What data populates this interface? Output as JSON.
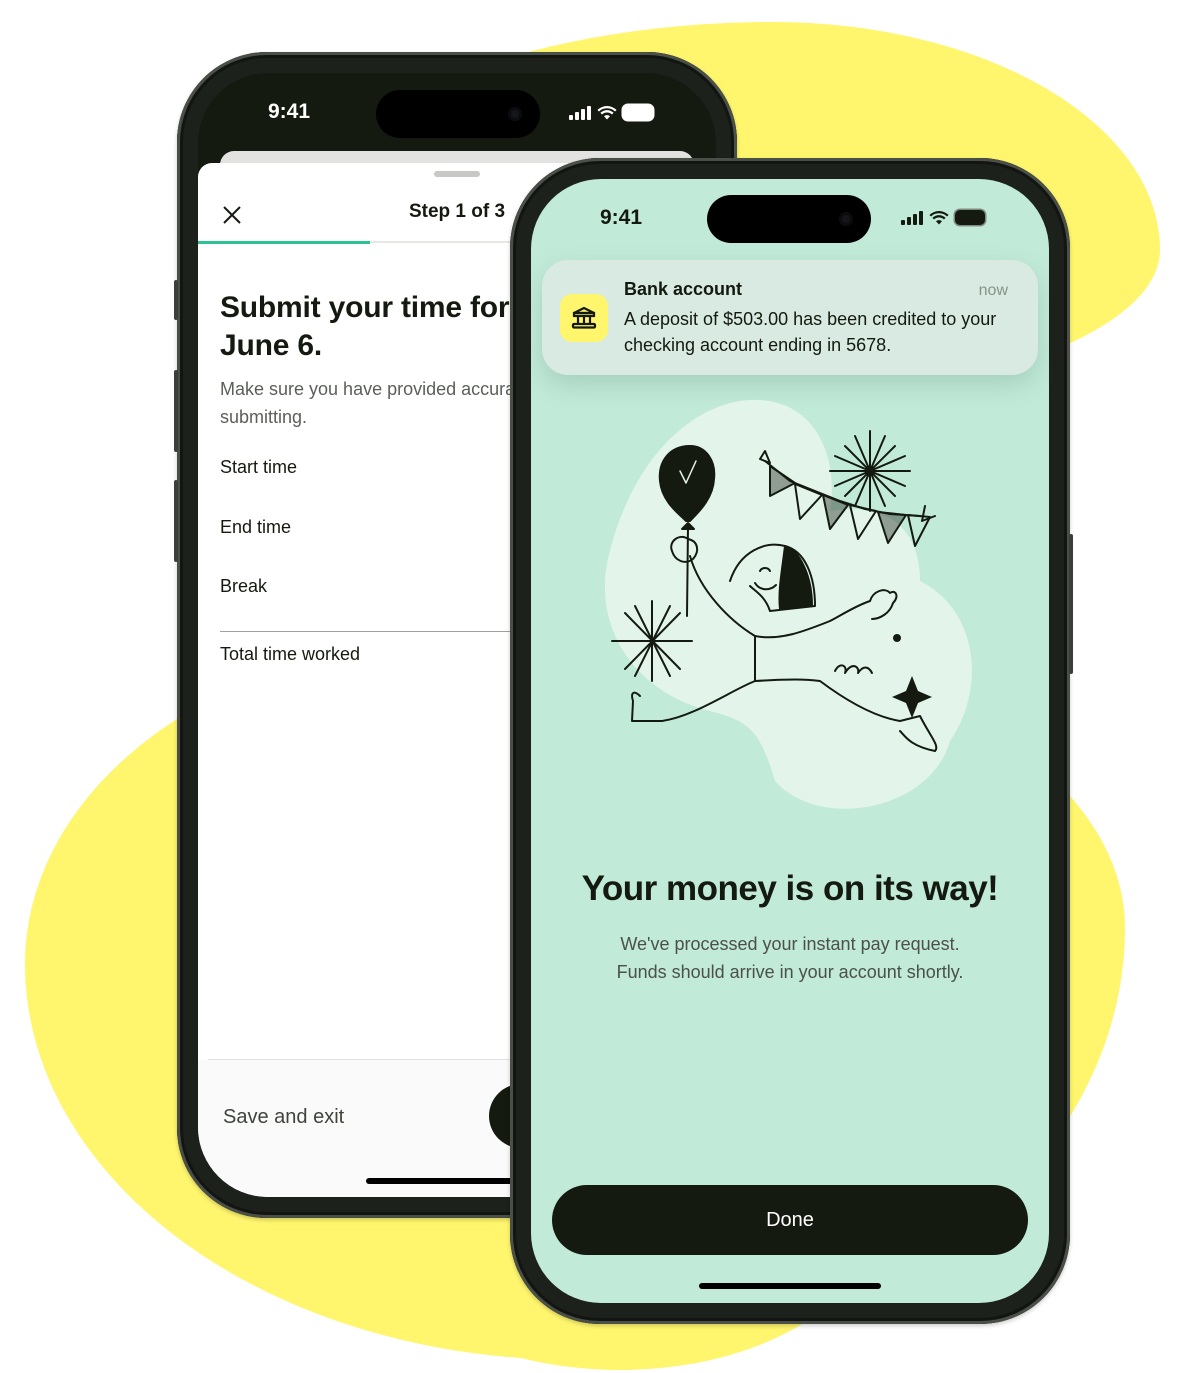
{
  "background": {
    "accent_color": "#fff66e"
  },
  "back_phone": {
    "status_bar": {
      "time": "9:41"
    },
    "sheet": {
      "step_label": "Step 1 of 3",
      "progress_fraction": 0.333,
      "progress_color": "#2ec295",
      "title": "Submit your time for Pearl on June 6.",
      "subtitle": "Make sure you have provided accurate times before submitting.",
      "fields": [
        {
          "label": "Start time"
        },
        {
          "label": "End time"
        },
        {
          "label": "Break"
        }
      ],
      "total_label": "Total time worked",
      "save_exit_label": "Save and exit"
    }
  },
  "front_phone": {
    "status_bar": {
      "time": "9:41"
    },
    "screen_color": "#c2ead9",
    "notification": {
      "icon": "bank-icon",
      "title": "Bank account",
      "time": "now",
      "body": "A deposit of $503.00 has been credited to your checking account ending in 5678."
    },
    "illustration": "celebrating-person-with-balloon",
    "headline": "Your money is on its way!",
    "subtext_line1": "We've processed your instant pay request.",
    "subtext_line2": "Funds should arrive in your account shortly.",
    "done_label": "Done"
  }
}
